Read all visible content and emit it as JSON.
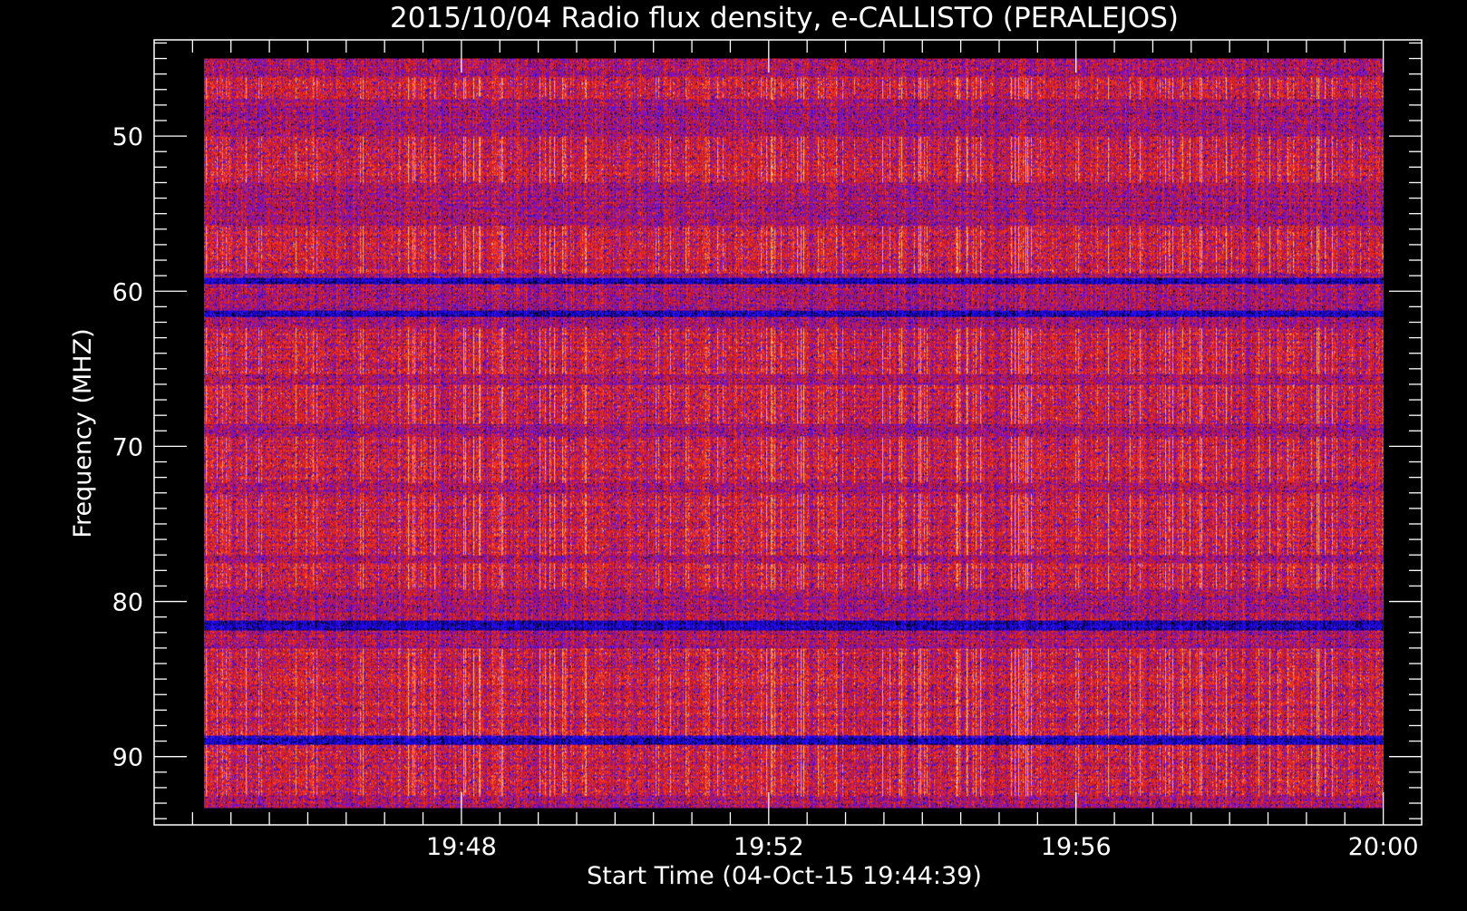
{
  "chart_data": {
    "type": "heatmap",
    "title": "2015/10/04  Radio flux density, e-CALLISTO (PERALEJOS)",
    "xlabel": "Start Time (04-Oct-15 19:44:39)",
    "ylabel": "Frequency (MHZ)",
    "x_range": [
      "19:44:39",
      "20:00:00"
    ],
    "xlim": [
      "19:44:00",
      "20:00:30"
    ],
    "ylim": [
      94.4,
      43.8
    ],
    "y_inverted": true,
    "x_ticks": [
      "19:48",
      "19:52",
      "19:56",
      "20:00"
    ],
    "y_ticks": [
      50,
      60,
      70,
      80,
      90
    ],
    "y_range": [
      45.0,
      93.3
    ],
    "colormap": [
      "#000000",
      "#1a00cc",
      "#2a14ff",
      "#7a10c8",
      "#c81e28",
      "#ff3a1a",
      "#ffb070"
    ],
    "bright_frequency_bands_mhz": [
      [
        46.2,
        47.6
      ],
      [
        50.0,
        53.0
      ],
      [
        55.8,
        58.8
      ],
      [
        62.3,
        65.3
      ],
      [
        66.0,
        68.5
      ],
      [
        69.3,
        72.3
      ],
      [
        73.0,
        77.0
      ],
      [
        77.5,
        79.2
      ],
      [
        83.0,
        88.8
      ],
      [
        89.2,
        92.5
      ]
    ],
    "grid": false,
    "legend": "none"
  }
}
